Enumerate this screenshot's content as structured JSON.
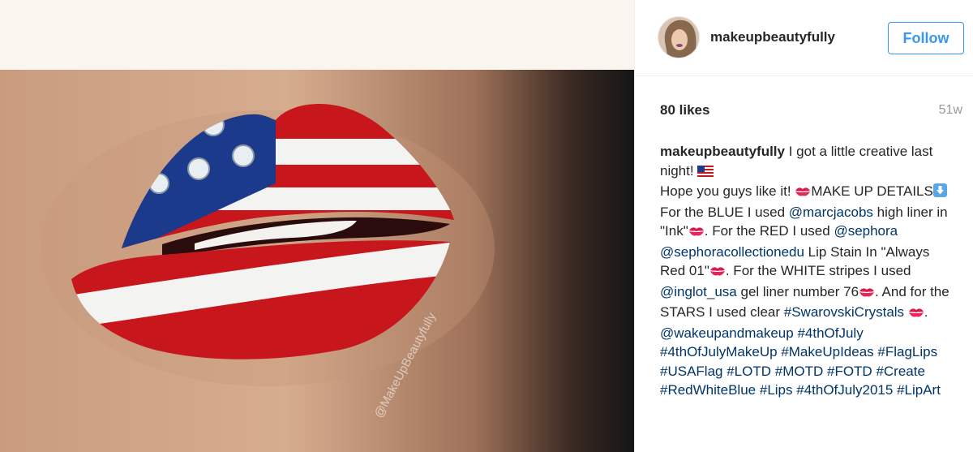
{
  "post": {
    "username": "makeupbeautyfully",
    "follow_label": "Follow",
    "likes": "80 likes",
    "age": "51w",
    "watermark": "@MakeUpBeautyfully",
    "caption": {
      "author": "makeupbeautyfully",
      "t1": " I got a little creative last night! ",
      "t2": "Hope you guys like it! ",
      "t3": "MAKE UP DETAILS",
      "t4": "For the BLUE I used ",
      "m_marcjacobs": "@marcjacobs",
      "t5": " high liner in \"Ink\"",
      "t6": ". For the RED I used ",
      "m_sephora": "@sephora",
      "t7": " ",
      "m_sephoracollection": "@sephoracollectionedu",
      "t8": " Lip Stain In \"Always Red 01\"",
      "t9": ". For the WHITE stripes I used ",
      "m_inglot": "@inglot_usa",
      "t10": " gel liner number 76",
      "t11": ". And for the STARS I used clear ",
      "h_swarovski": "#SwarovskiCrystals",
      "t12": " ",
      "t13": ". ",
      "m_wakeup": "@wakeupandmakeup",
      "tags": [
        "#4thOfJuly",
        "#4thOfJulyMakeUp",
        "#MakeUpIdeas",
        "#FlagLips",
        "#USAFlag",
        "#LOTD",
        "#MOTD",
        "#FOTD",
        "#Create",
        "#RedWhiteBlue",
        "#Lips",
        "#4thOfJuly2015",
        "#LipArt"
      ]
    }
  },
  "icons": {
    "flag": "us-flag-icon",
    "kiss": "kiss-mark-icon",
    "arrow": "down-arrow-icon"
  },
  "colors": {
    "accent": "#3897f0",
    "link": "#003569",
    "lip_red": "#c8161d",
    "lip_blue": "#1c3a8c"
  }
}
